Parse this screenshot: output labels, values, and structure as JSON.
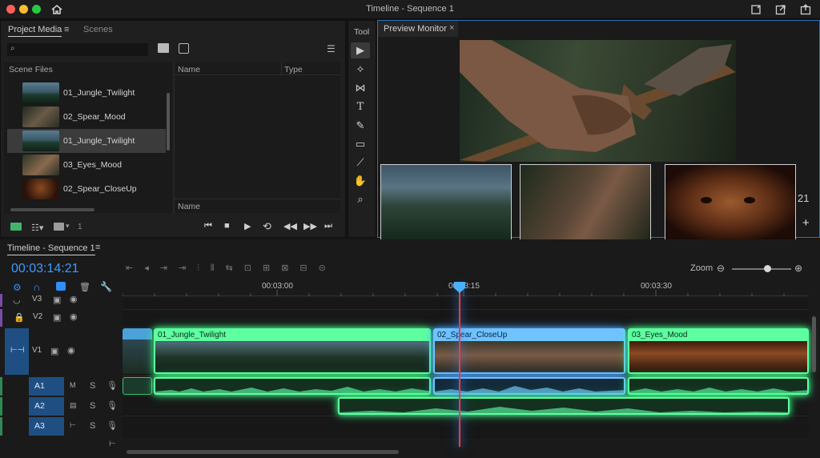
{
  "window": {
    "title": "Timeline - Sequence 1"
  },
  "project": {
    "tabs": [
      "Project Media",
      "Scenes"
    ],
    "list_header": "Scene Files",
    "items": [
      {
        "label": "01_Jungle_Twilight",
        "thumb": "jungle"
      },
      {
        "label": "02_Spear_Mood",
        "thumb": "spear"
      },
      {
        "label": "01_Jungle_Twilight",
        "thumb": "jungle",
        "selected": true
      },
      {
        "label": "03_Eyes_Mood",
        "thumb": "spear2"
      },
      {
        "label": "02_Spear_CloseUp",
        "thumb": "eyes"
      }
    ],
    "col_name": "Name",
    "col_type": "Type",
    "footer_name": "Name",
    "footer_count": "1"
  },
  "tools": {
    "label": "Tool"
  },
  "preview": {
    "tab": "Preview Monitor",
    "timecode_partial": "21"
  },
  "timeline": {
    "tab": "Timeline - Sequence 1",
    "timecode": "00:03:14:21",
    "zoom_label": "Zoom",
    "zoom_level": 0.6,
    "ruler": [
      "00:03:00",
      "00:03:15",
      "00:03:30"
    ],
    "tracks_video": [
      "V3",
      "V2",
      "V1"
    ],
    "tracks_audio": [
      "A1",
      "A2",
      "A3"
    ],
    "clips": [
      "01_Jungle_Twilight",
      "02_Spear_CloseUp",
      "03_Eyes_Mood"
    ]
  },
  "colors": {
    "accent": "#2f8fff",
    "clip_green": "#5dffa0",
    "clip_blue": "#6fc3ff",
    "playhead": "#ff3b3b"
  }
}
